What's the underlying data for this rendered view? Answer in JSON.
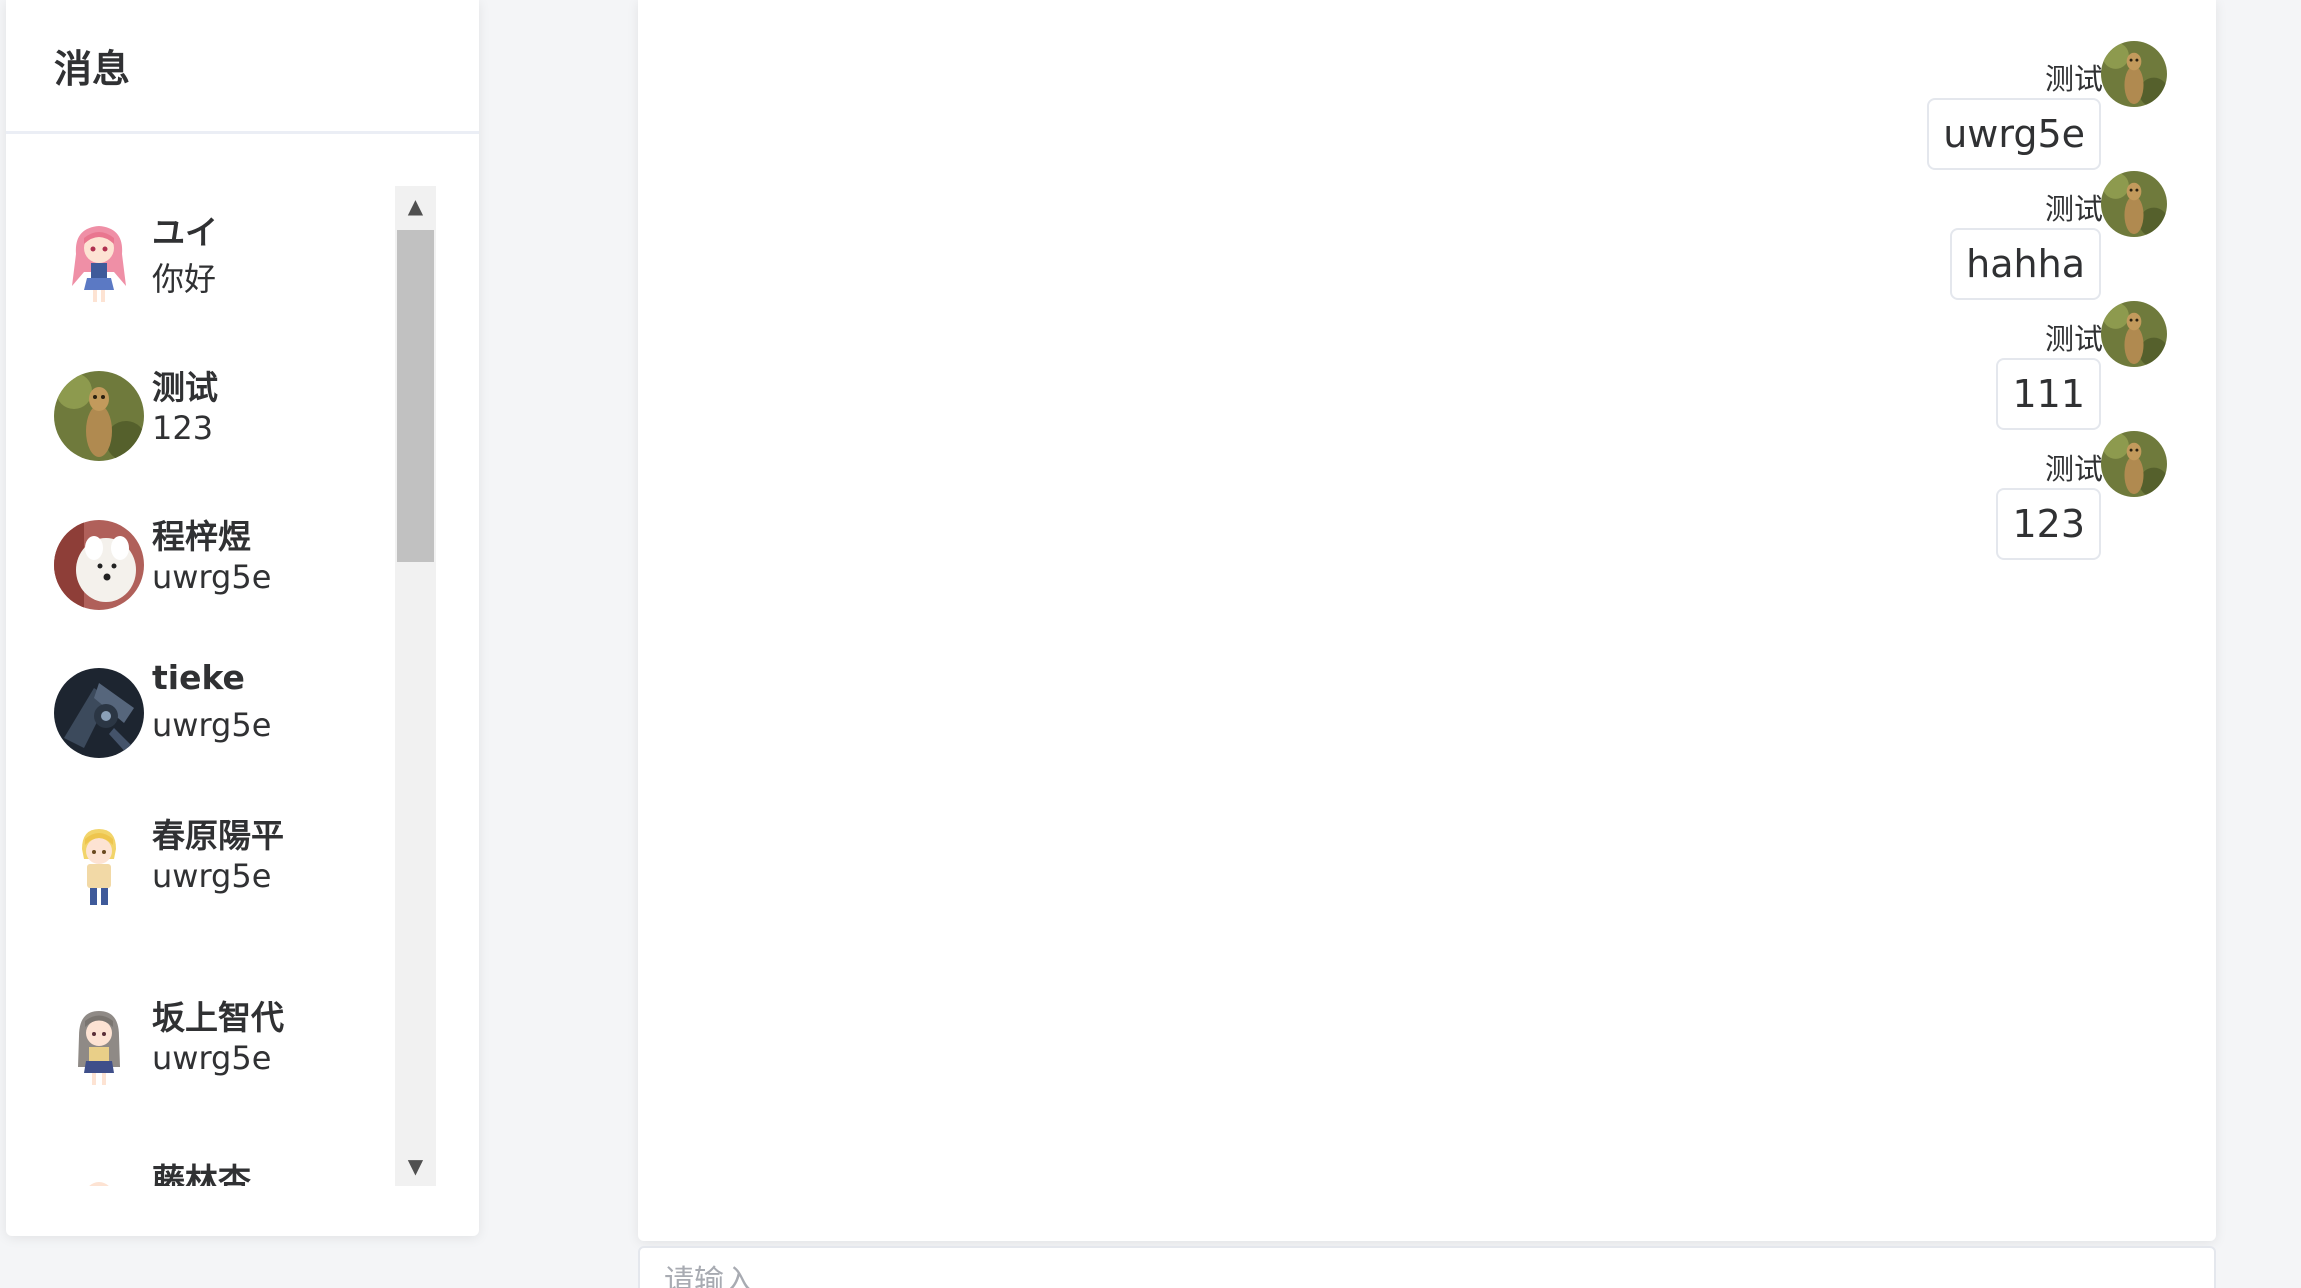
{
  "sidebar": {
    "title": "消息",
    "conversations": [
      {
        "name": "ユイ",
        "last_message": "你好",
        "avatar": "pink-hair-anime-girl-avatar"
      },
      {
        "name": "测试",
        "last_message": "123",
        "avatar": "meerkat-photo-avatar"
      },
      {
        "name": "程梓煜",
        "last_message": "uwrg5e",
        "avatar": "white-dog-photo-avatar"
      },
      {
        "name": "tieke",
        "last_message": "uwrg5e",
        "avatar": "dark-mech-avatar"
      },
      {
        "name": "春原陽平",
        "last_message": "uwrg5e",
        "avatar": "blonde-anime-boy-avatar"
      },
      {
        "name": "坂上智代",
        "last_message": "uwrg5e",
        "avatar": "grey-hair-anime-girl-avatar"
      },
      {
        "name": "藤林杏",
        "last_message": "",
        "avatar": "anime-avatar"
      }
    ],
    "scroll_up_icon": "▲",
    "scroll_down_icon": "▼"
  },
  "chat": {
    "messages": [
      {
        "sender": "测试",
        "text": "uwrg5e",
        "avatar": "meerkat-photo-avatar"
      },
      {
        "sender": "测试",
        "text": "hahha",
        "avatar": "meerkat-photo-avatar"
      },
      {
        "sender": "测试",
        "text": "111",
        "avatar": "meerkat-photo-avatar"
      },
      {
        "sender": "测试",
        "text": "123",
        "avatar": "meerkat-photo-avatar"
      }
    ]
  },
  "input": {
    "placeholder": "请输入",
    "value": ""
  },
  "colors": {
    "page_background": "#f4f5f7",
    "panel_background": "#ffffff",
    "text": "#303133",
    "border": "#e4e7ed",
    "scrollbar_track": "#f1f1f1",
    "scrollbar_thumb": "#c1c1c1"
  }
}
